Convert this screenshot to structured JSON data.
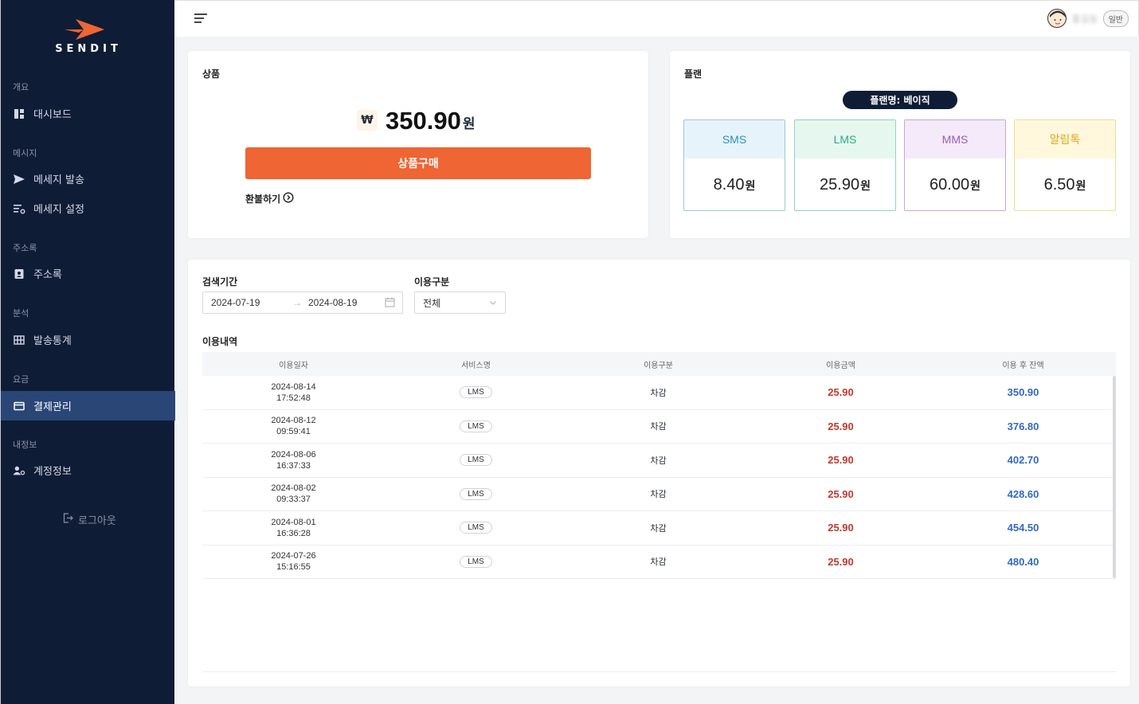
{
  "brand": {
    "name": "SENDIT",
    "accent": "#ef6533"
  },
  "sidebar": {
    "sections": [
      {
        "title": "개요",
        "items": [
          {
            "label": "대시보드",
            "icon": "dashboard-icon"
          }
        ]
      },
      {
        "title": "메시지",
        "items": [
          {
            "label": "메세지 발송",
            "icon": "send-icon"
          },
          {
            "label": "메세지 설정",
            "icon": "settings-list-icon"
          }
        ]
      },
      {
        "title": "주소록",
        "items": [
          {
            "label": "주소록",
            "icon": "contact-icon"
          }
        ]
      },
      {
        "title": "분석",
        "items": [
          {
            "label": "발송통계",
            "icon": "grid-icon"
          }
        ]
      },
      {
        "title": "요금",
        "items": [
          {
            "label": "결제관리",
            "icon": "card-icon",
            "active": true
          }
        ]
      },
      {
        "title": "내정보",
        "items": [
          {
            "label": "계정정보",
            "icon": "user-settings-icon"
          }
        ]
      }
    ],
    "logout": "로그아웃"
  },
  "header": {
    "user_name": "홍길동",
    "user_badge": "일반"
  },
  "product": {
    "title": "상품",
    "currency_symbol": "₩",
    "price": "350.90",
    "price_unit": "원",
    "buy_label": "상품구매",
    "refund_label": "환불하기"
  },
  "plan": {
    "title": "플랜",
    "plan_name": "플랜명: 베이직",
    "items": [
      {
        "name": "SMS",
        "value": "8.40",
        "unit": "원",
        "color": "#2a8fbf",
        "bg": "#e7f3fb",
        "border": "#9fc6de"
      },
      {
        "name": "LMS",
        "value": "25.90",
        "unit": "원",
        "color": "#2bab84",
        "bg": "#e6f7f0",
        "border": "#92d3bc"
      },
      {
        "name": "MMS",
        "value": "60.00",
        "unit": "원",
        "color": "#9a5bb3",
        "bg": "#f4eafa",
        "border": "#c8a6d8"
      },
      {
        "name": "알림톡",
        "value": "6.50",
        "unit": "원",
        "color": "#e2a51d",
        "bg": "#fff8dc",
        "border": "#f1dd92"
      }
    ]
  },
  "usage": {
    "period_label": "검색기간",
    "start_date": "2024-07-19",
    "end_date": "2024-08-19",
    "type_label": "이용구분",
    "type_value": "전체",
    "history_title": "이용내역",
    "columns": [
      "이용일자",
      "서비스명",
      "이용구분",
      "이용금액",
      "이용 후 잔액"
    ],
    "rows": [
      {
        "date": "2024-08-14",
        "time": "17:52:48",
        "service": "LMS",
        "type": "차감",
        "amount": "25.90",
        "balance": "350.90"
      },
      {
        "date": "2024-08-12",
        "time": "09:59:41",
        "service": "LMS",
        "type": "차감",
        "amount": "25.90",
        "balance": "376.80"
      },
      {
        "date": "2024-08-06",
        "time": "16:37:33",
        "service": "LMS",
        "type": "차감",
        "amount": "25.90",
        "balance": "402.70"
      },
      {
        "date": "2024-08-02",
        "time": "09:33:37",
        "service": "LMS",
        "type": "차감",
        "amount": "25.90",
        "balance": "428.60"
      },
      {
        "date": "2024-08-01",
        "time": "16:36:28",
        "service": "LMS",
        "type": "차감",
        "amount": "25.90",
        "balance": "454.50"
      },
      {
        "date": "2024-07-26",
        "time": "15:16:55",
        "service": "LMS",
        "type": "차감",
        "amount": "25.90",
        "balance": "480.40"
      }
    ]
  }
}
